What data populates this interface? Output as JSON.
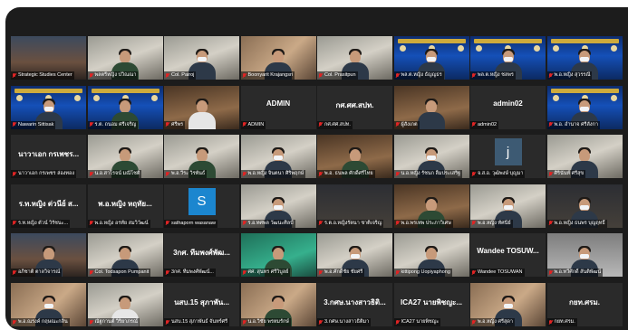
{
  "meeting": {
    "colors": {
      "stage": "#1c1c1c",
      "active_speaker": "#c9e24a",
      "muted_icon": "#e02424"
    },
    "participants": [
      {
        "label": "Strategic Studies Center",
        "kind": "video",
        "scene": "room",
        "person": "none",
        "speaking": true
      },
      {
        "label": "พลตรีหญิง ปวิณณา",
        "kind": "video",
        "scene": "office",
        "person": "uniform"
      },
      {
        "label": "Col. Pairoj",
        "kind": "video",
        "scene": "office",
        "person": "mask"
      },
      {
        "label": "Boonyarit Krajangsri",
        "kind": "video",
        "scene": "warm",
        "person": "plain"
      },
      {
        "label": "Col. Prasitpun",
        "kind": "video",
        "scene": "office",
        "person": "plain"
      },
      {
        "label": "พล.ต.หญิง ธัญญธร",
        "kind": "video",
        "scene": "conf",
        "person": "mask"
      },
      {
        "label": "พล.ต.หญิง ชลพร",
        "kind": "video",
        "scene": "conf",
        "person": "mask"
      },
      {
        "label": "พ.อ.หญิง สุวรรณี",
        "kind": "video",
        "scene": "conf",
        "person": "mask"
      },
      {
        "label": "Nawarin Sittisak",
        "kind": "video",
        "scene": "conf",
        "person": "mask"
      },
      {
        "label": "ร.ต. ถนอม ศรีเจริญ",
        "kind": "video",
        "scene": "conf",
        "person": "uniform"
      },
      {
        "label": "ศรีพร",
        "kind": "video",
        "scene": "wood",
        "person": "white"
      },
      {
        "label": "ADMIN",
        "kind": "name",
        "center": "ADMIN"
      },
      {
        "label": "กศ.ศศ.สปท.",
        "kind": "name",
        "center": "กศ.ศศ.สปท."
      },
      {
        "label": "ผู้สังเกต",
        "kind": "video",
        "scene": "wood",
        "person": "plain"
      },
      {
        "label": "admin02",
        "kind": "name",
        "center": "admin02"
      },
      {
        "label": "พ.อ. อำนาจ ศรีลังกา",
        "kind": "video",
        "scene": "conf",
        "person": "mask"
      },
      {
        "label": "นาวาเอก กรเพชร ล่องทอง",
        "kind": "name",
        "center": "นาวาเอก กรเพชร..."
      },
      {
        "label": "น.อ.สาโรจน์ มณีโชติ",
        "kind": "video",
        "scene": "office",
        "person": "uniform"
      },
      {
        "label": "พ.อ.วีระ วิรพันธ์",
        "kind": "video",
        "scene": "office",
        "person": "uniform"
      },
      {
        "label": "พ.อ.หญิง จินตนา ศิริพฤกษ์",
        "kind": "video",
        "scene": "office",
        "person": "mask"
      },
      {
        "label": "พ.อ. ธนพล ศักดิ์ศรีไทย",
        "kind": "video",
        "scene": "wood",
        "person": "uniform"
      },
      {
        "label": "น.อ.หญิง รัชนก ลิ้มประเสริฐ",
        "kind": "video",
        "scene": "office",
        "person": "mask"
      },
      {
        "label": "จ.ส.อ. วุฒิพงษ์ บุญมา",
        "kind": "avatar",
        "initial": "j",
        "tone": "slate"
      },
      {
        "label": "ศิรินันท์ ศรีสุข",
        "kind": "video",
        "scene": "office",
        "person": "plain"
      },
      {
        "label": "ร.ท.หญิง ตัวน์ วิรัชนะ...",
        "kind": "name",
        "center": "ร.ท.หญิง ต่วนีย์ ส..."
      },
      {
        "label": "พ.อ.หญิง อรทัย สมวิวัฒน์",
        "kind": "name",
        "center": "พ.อ.หญิง หฤทัย..."
      },
      {
        "label": "sathaporn wasanaw",
        "kind": "avatar",
        "initial": "S",
        "tone": "blue"
      },
      {
        "label": "ร.อ.ทศพล วัฒนะศิลป์",
        "kind": "video",
        "scene": "office",
        "person": "mask"
      },
      {
        "label": "ร.ต.อ.หญิงรัตนา ชาติเจริญ",
        "kind": "video",
        "scene": "dark",
        "person": "none"
      },
      {
        "label": "พ.อ.พรเทพ ประภาวิเศษ",
        "kind": "video",
        "scene": "wood",
        "person": "uniform"
      },
      {
        "label": "พ.อ.หญิง ทัศนีย์",
        "kind": "video",
        "scene": "office",
        "person": "mask"
      },
      {
        "label": "พ.อ.หญิง ธนพร บุญฤทธิ์",
        "kind": "video",
        "scene": "dark",
        "person": "mask"
      },
      {
        "label": "อภิชาติ ตาลวิจารณ์",
        "kind": "video",
        "scene": "room",
        "person": "plain"
      },
      {
        "label": "Col. Todsapon Pumpanit",
        "kind": "video",
        "scene": "office",
        "person": "plain"
      },
      {
        "label": "3กศ. ทีมพงศ์พัฒน์...",
        "kind": "name",
        "center": "3กศ. ทีมพงศ์พัฒ..."
      },
      {
        "label": "ศศ. สุนทร ศรีวิบูลย์",
        "kind": "video",
        "scene": "green",
        "person": "uniform"
      },
      {
        "label": "พ.อ.ศักดิ์ชัย ชัยศรี",
        "kind": "video",
        "scene": "office",
        "person": "mask"
      },
      {
        "label": "kittipong Uopiyaphong",
        "kind": "video",
        "scene": "office",
        "person": "plain"
      },
      {
        "label": "Wandee TOSUWAN",
        "kind": "name",
        "center": "Wandee TOSUW..."
      },
      {
        "label": "พ.อ.ทวีศักดิ์ สันติพัฒน์",
        "kind": "video",
        "scene": "grey",
        "person": "mask"
      },
      {
        "label": "พ.อ.ณรงค์ กฤษณะกลิ่น",
        "kind": "video",
        "scene": "warm",
        "person": "mask"
      },
      {
        "label": "ณัฐกานต์ วิริยาภรณ์",
        "kind": "video",
        "scene": "office",
        "person": "white"
      },
      {
        "label": "นสบ.15 สุภาพันธ์ จันทร์ศรี",
        "kind": "name",
        "center": "นสบ.15 สุภาพัน..."
      },
      {
        "label": "น.อ.วิชัย พรหมรักษ์",
        "kind": "video",
        "scene": "warm",
        "person": "uniform"
      },
      {
        "label": "3.กศษ.นางสาวธิติมา",
        "kind": "name",
        "center": "3.กศษ.นางสาวธิติ..."
      },
      {
        "label": "ICA27 นายพิชญะ",
        "kind": "name",
        "center": "ICA27 นายพิชญะ..."
      },
      {
        "label": "พ.อ.หญิง ศรีสุดา",
        "kind": "video",
        "scene": "warm",
        "person": "mask"
      },
      {
        "label": "กยท.ศรม.",
        "kind": "name",
        "center": "กยท.ศรม."
      }
    ]
  }
}
